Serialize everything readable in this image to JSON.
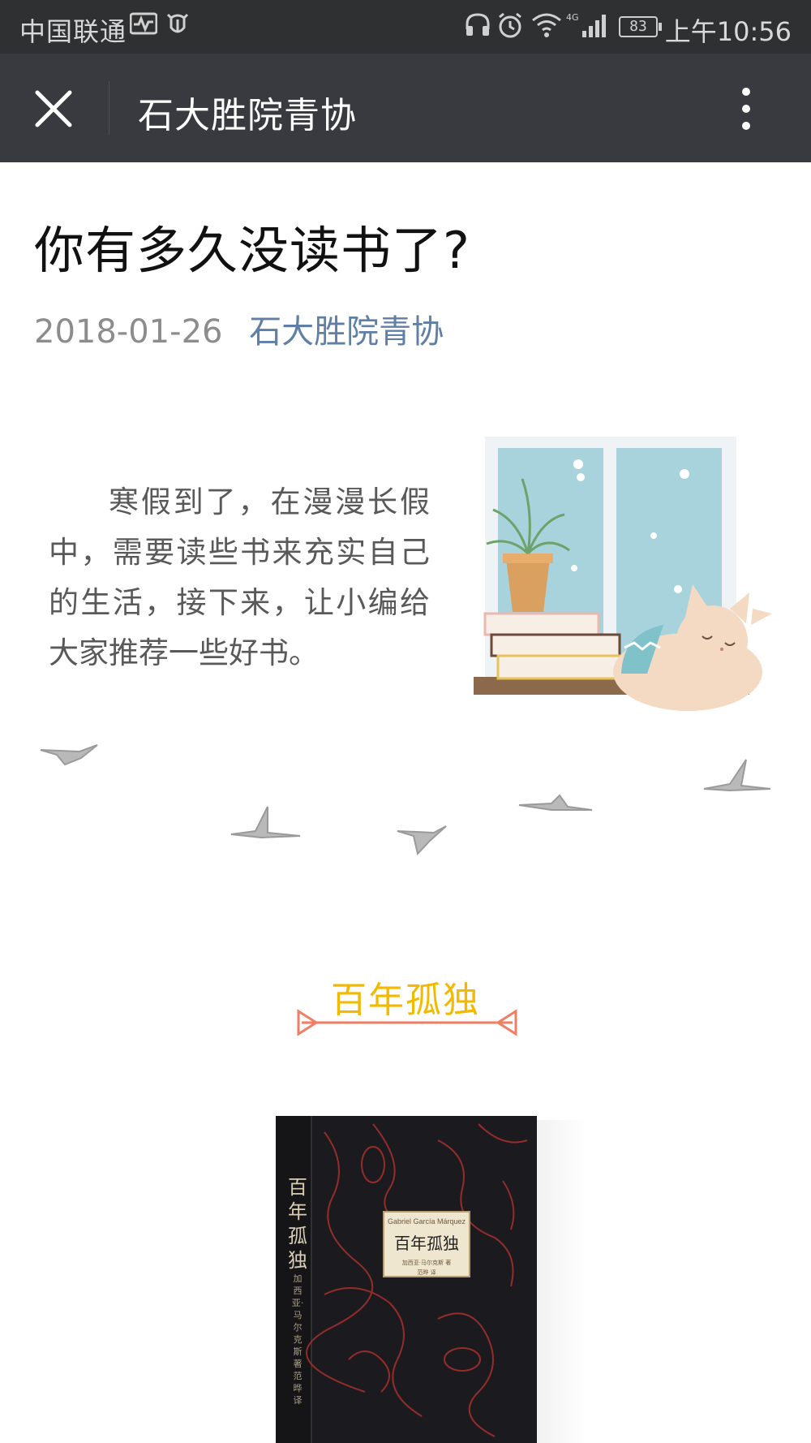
{
  "status_bar": {
    "carrier": "中国联通",
    "battery": "83",
    "time": "上午10:56",
    "icons": [
      "activity-icon",
      "alarm-bug-icon",
      "headphones-icon",
      "alarm-clock-icon",
      "wifi-icon",
      "4g-signal-icon",
      "battery-icon"
    ]
  },
  "nav": {
    "title": "石大胜院青协",
    "close_icon": "close-icon",
    "more_icon": "more-vertical-icon"
  },
  "article": {
    "title": "你有多久没读书了?",
    "date": "2018-01-26",
    "author": "石大胜院青协",
    "intro": "寒假到了，在漫漫长假中，需要读些书来充实自己的生活，接下来，让小编给大家推荐一些好书。",
    "section_title": "百年孤独",
    "book": {
      "spine_title": "百年孤独",
      "spine_author": "加西亚·马尔克斯 著 范晔 译",
      "label_author_en": "Gabriel García Márquez",
      "label_title": "百年孤独",
      "label_author": "加西亚·马尔克斯 著",
      "label_translator": "范晔 译"
    }
  },
  "colors": {
    "status_bar": "#2f3032",
    "nav_bar": "#393a3f",
    "author_link": "#607fa6",
    "section_title": "#f2b900",
    "arrow": "#f07d64"
  }
}
